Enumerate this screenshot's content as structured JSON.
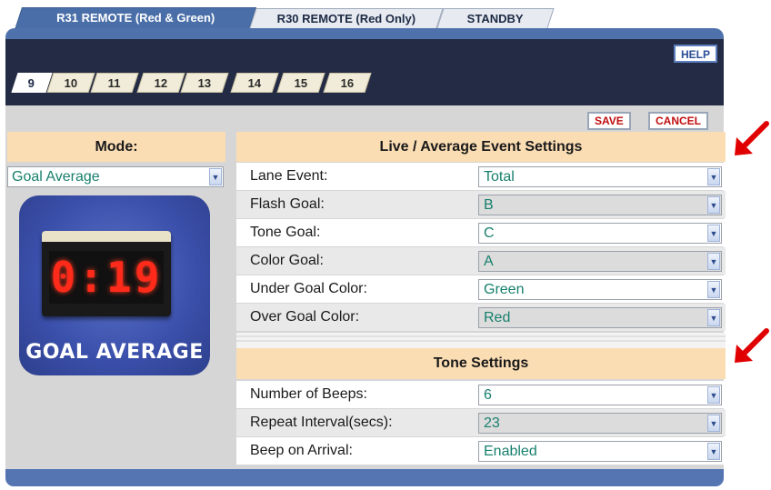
{
  "top_tabs": [
    {
      "label": "R31 REMOTE (Red & Green)",
      "active": true
    },
    {
      "label": "R30 REMOTE (Red Only)",
      "active": false
    },
    {
      "label": "STANDBY",
      "active": false
    }
  ],
  "help_label": "HELP",
  "lane_tabs": [
    "9",
    "10",
    "11",
    "12",
    "13",
    "14",
    "15",
    "16"
  ],
  "active_lane": "9",
  "actions": {
    "save_label": "SAVE",
    "cancel_label": "CANCEL"
  },
  "mode": {
    "header": "Mode:",
    "selected": "Goal Average",
    "image": {
      "display_time": "0:19",
      "caption": "GOAL AVERAGE"
    }
  },
  "live_settings": {
    "header": "Live / Average Event Settings",
    "rows": [
      {
        "label": "Lane Event:",
        "value": "Total"
      },
      {
        "label": "Flash Goal:",
        "value": "B"
      },
      {
        "label": "Tone Goal:",
        "value": "C"
      },
      {
        "label": "Color Goal:",
        "value": "A"
      },
      {
        "label": "Under Goal Color:",
        "value": "Green"
      },
      {
        "label": "Over Goal Color:",
        "value": "Red"
      }
    ]
  },
  "tone_settings": {
    "header": "Tone Settings",
    "rows": [
      {
        "label": "Number of Beeps:",
        "value": "6"
      },
      {
        "label": "Repeat Interval(secs):",
        "value": "23"
      },
      {
        "label": "Beep on Arrival:",
        "value": "Enabled"
      }
    ]
  },
  "colors": {
    "tab_blue": "#4a6fa8",
    "navy": "#242b44",
    "section_peach": "#fbddb4",
    "value_teal": "#17806d",
    "action_red": "#c10d0d",
    "arrow_red": "#e00000"
  }
}
